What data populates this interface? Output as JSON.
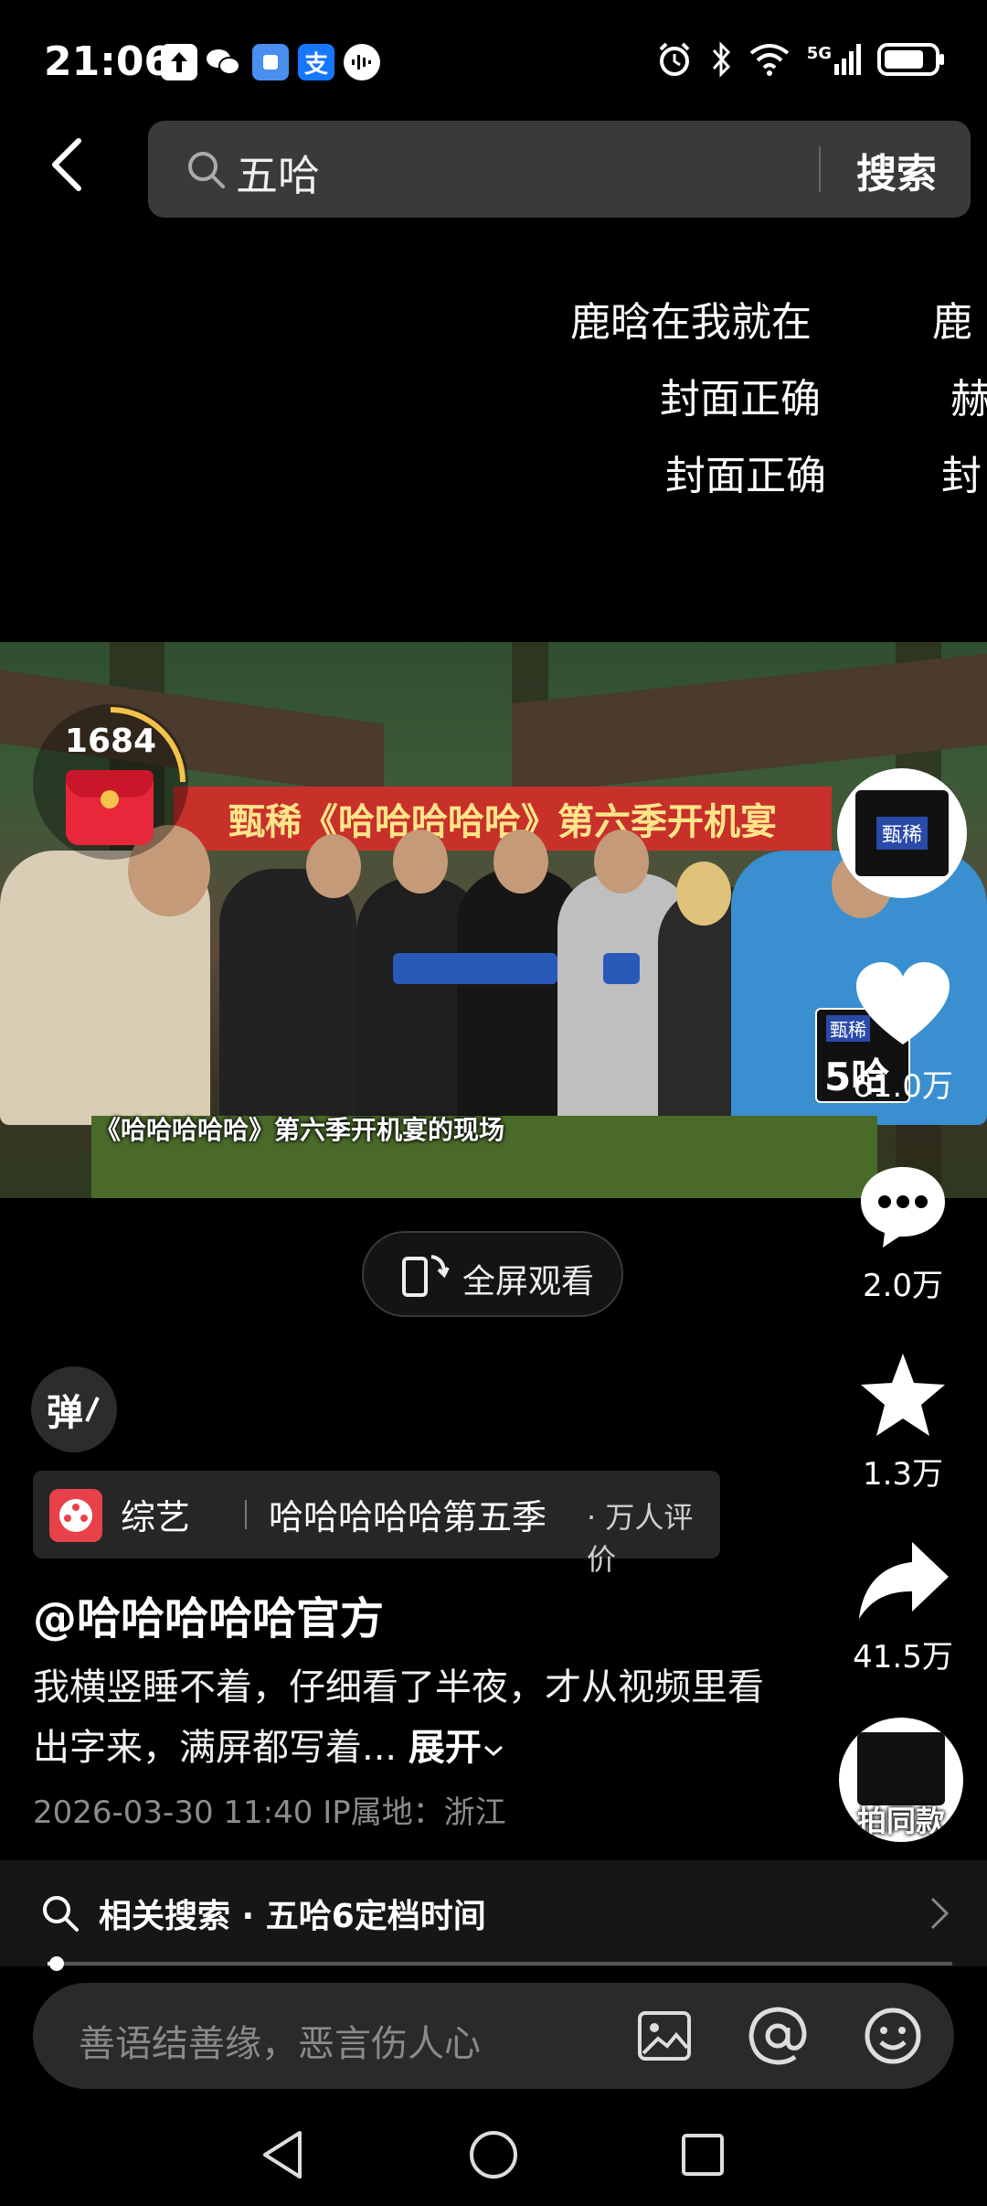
{
  "status_bar": {
    "time": "21:06",
    "app_icons": [
      "upload-icon",
      "wechat-icon",
      "app-icon",
      "alipay-icon",
      "voice-icon"
    ],
    "alipay_glyph": "支",
    "right_icons": [
      "alarm-icon",
      "bluetooth-icon",
      "wifi-icon",
      "5g-signal-icon",
      "battery-icon"
    ],
    "network": "5G"
  },
  "search": {
    "query": "五哈",
    "button": "搜索"
  },
  "danmaku": [
    "鹿晗在我就在",
    "鹿",
    "封面正确",
    "赫",
    "封面正确",
    "封"
  ],
  "video": {
    "banner_text": "甄稀《哈哈哈哈哈》第六季开机宴",
    "caption": "《哈哈哈哈哈》第六季开机宴的现场",
    "logo_text": "甄稀",
    "season_badge": "5哈"
  },
  "red_packet": {
    "count": "1684"
  },
  "right_rail": {
    "avatar_label": "甄稀",
    "like_count": "61.0万",
    "comment_count": "2.0万",
    "favorite_count": "1.3万",
    "share_count": "41.5万",
    "same_style_label": "拍同款"
  },
  "fullscreen": {
    "label": "全屏观看"
  },
  "danmaku_toggle": {
    "label": "弹"
  },
  "tag": {
    "category": "综艺",
    "title": "哈哈哈哈哈第五季",
    "rating": "· 万人评价"
  },
  "post": {
    "author": "@哈哈哈哈哈官方",
    "description": "我横竖睡不着，仔细看了半夜，才从视频里看出字来，满屏都写着...",
    "expand": "展开",
    "meta": "2026-03-30 11:40  IP属地：浙江"
  },
  "related_search": {
    "text": "相关搜索 · 五哈6定档时间"
  },
  "progress": {
    "fraction": 0.01
  },
  "comment": {
    "placeholder": "善语结善缘，恶言伤人心"
  },
  "colors": {
    "background": "#000000",
    "search_bg": "#3a3a3a",
    "red_packet": "#e8283a",
    "tag_icon": "#e8414a"
  }
}
